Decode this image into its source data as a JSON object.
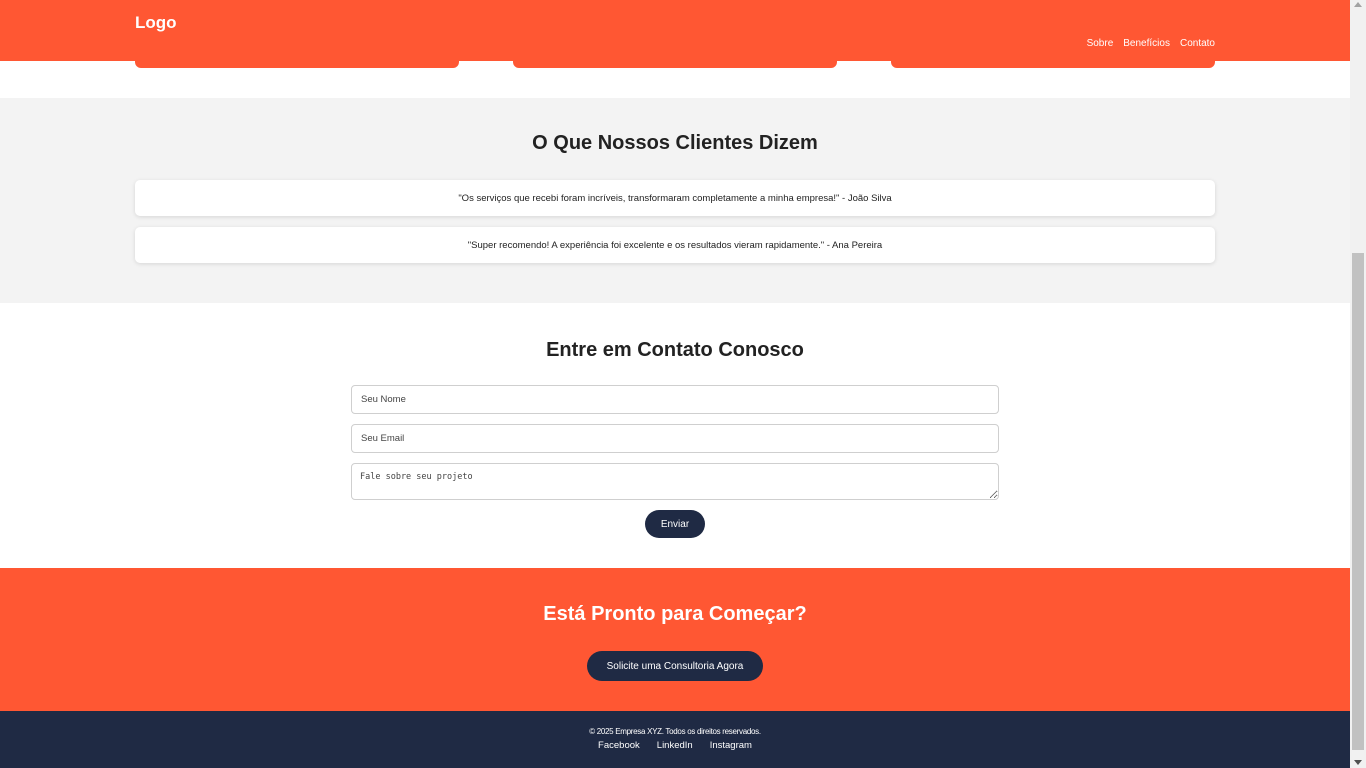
{
  "header": {
    "logo": "Logo",
    "nav": [
      "Sobre",
      "Benefícios",
      "Contato"
    ]
  },
  "testimonials": {
    "title": "O Que Nossos Clientes Dizem",
    "items": [
      "\"Os serviços que recebi foram incríveis, transformaram completamente a minha empresa!\" - João Silva",
      "\"Super recomendo! A experiência foi excelente e os resultados vieram rapidamente.\" - Ana Pereira"
    ]
  },
  "contact": {
    "title": "Entre em Contato Conosco",
    "name_placeholder": "Seu Nome",
    "email_placeholder": "Seu Email",
    "message_placeholder": "Fale sobre seu projeto",
    "submit_label": "Enviar"
  },
  "cta": {
    "title": "Está Pronto para Começar?",
    "button_label": "Solicite uma Consultoria Agora"
  },
  "footer": {
    "copyright": "© 2025 Empresa XYZ. Todos os direitos reservados.",
    "links": [
      "Facebook",
      "LinkedIn",
      "Instagram"
    ]
  },
  "colors": {
    "accent": "#ff5733",
    "dark": "#1f2a44",
    "light_bg": "#f3f3f3"
  }
}
